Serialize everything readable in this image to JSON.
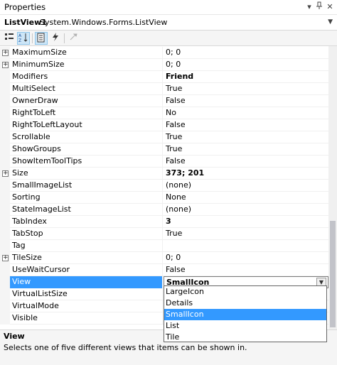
{
  "window": {
    "title": "Properties",
    "pin_glyph": "▾",
    "close_glyph": "✕"
  },
  "object_selector": {
    "name": "ListView1",
    "type": "System.Windows.Forms.ListView"
  },
  "toolbar": {
    "categorized_icon": "categorized-icon",
    "alphabetical_icon": "alphabetical-icon",
    "properties_icon": "properties-icon",
    "events_icon": "events-icon",
    "property_pages_icon": "property-pages-icon"
  },
  "properties": [
    {
      "name": "MaximumSize",
      "value": "0; 0",
      "expandable": true,
      "bold": false
    },
    {
      "name": "MinimumSize",
      "value": "0; 0",
      "expandable": true,
      "bold": false
    },
    {
      "name": "Modifiers",
      "value": "Friend",
      "expandable": false,
      "bold": true
    },
    {
      "name": "MultiSelect",
      "value": "True",
      "expandable": false,
      "bold": false
    },
    {
      "name": "OwnerDraw",
      "value": "False",
      "expandable": false,
      "bold": false
    },
    {
      "name": "RightToLeft",
      "value": "No",
      "expandable": false,
      "bold": false
    },
    {
      "name": "RightToLeftLayout",
      "value": "False",
      "expandable": false,
      "bold": false
    },
    {
      "name": "Scrollable",
      "value": "True",
      "expandable": false,
      "bold": false
    },
    {
      "name": "ShowGroups",
      "value": "True",
      "expandable": false,
      "bold": false
    },
    {
      "name": "ShowItemToolTips",
      "value": "False",
      "expandable": false,
      "bold": false
    },
    {
      "name": "Size",
      "value": "373; 201",
      "expandable": true,
      "bold": true
    },
    {
      "name": "SmallImageList",
      "value": "(none)",
      "expandable": false,
      "bold": false
    },
    {
      "name": "Sorting",
      "value": "None",
      "expandable": false,
      "bold": false
    },
    {
      "name": "StateImageList",
      "value": "(none)",
      "expandable": false,
      "bold": false
    },
    {
      "name": "TabIndex",
      "value": "3",
      "expandable": false,
      "bold": true
    },
    {
      "name": "TabStop",
      "value": "True",
      "expandable": false,
      "bold": false
    },
    {
      "name": "Tag",
      "value": "",
      "expandable": false,
      "bold": false
    },
    {
      "name": "TileSize",
      "value": "0; 0",
      "expandable": true,
      "bold": false
    },
    {
      "name": "UseWaitCursor",
      "value": "False",
      "expandable": false,
      "bold": false
    },
    {
      "name": "View",
      "value": "SmallIcon",
      "expandable": false,
      "bold": true,
      "selected": true
    },
    {
      "name": "VirtualListSize",
      "value": "",
      "expandable": false,
      "bold": false
    },
    {
      "name": "VirtualMode",
      "value": "",
      "expandable": false,
      "bold": false
    },
    {
      "name": "Visible",
      "value": "",
      "expandable": false,
      "bold": false
    }
  ],
  "view_dropdown": {
    "options": [
      "LargeIcon",
      "Details",
      "SmallIcon",
      "List",
      "Tile"
    ],
    "selected": "SmallIcon"
  },
  "description": {
    "title": "View",
    "text": "Selects one of five different views that items can be shown in."
  },
  "colors": {
    "selection": "#3399ff",
    "panel": "#f5f5f5"
  }
}
